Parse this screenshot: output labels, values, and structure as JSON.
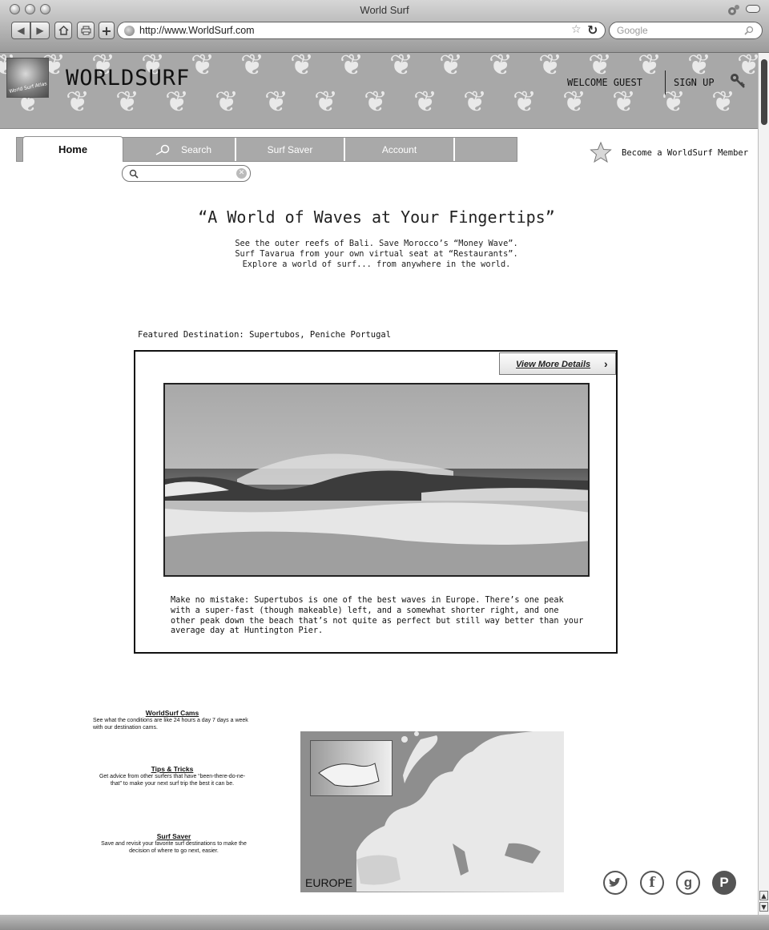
{
  "browser": {
    "window_title": "World Surf",
    "url": "http://www.WorldSurf.com",
    "search_placeholder": "Google"
  },
  "header": {
    "logo_text": "World Surf Atlas",
    "site_name": "WORLDSURF",
    "welcome": "WELCOME GUEST",
    "signup": "SIGN UP"
  },
  "nav": {
    "tabs": [
      {
        "label": "Home",
        "active": true
      },
      {
        "label": "Search",
        "active": false
      },
      {
        "label": "Surf Saver",
        "active": false
      },
      {
        "label": "Account",
        "active": false
      },
      {
        "label": "",
        "active": false
      }
    ],
    "member_link": "Become a WorldSurf Member"
  },
  "hero": {
    "title": "“A World of Waves at Your Fingertips”",
    "text": "See the outer reefs of Bali. Save Morocco’s “Money Wave”. Surf Tavarua from your own virtual seat at “Restaurants”. Explore a world of surf... from anywhere in the world."
  },
  "featured": {
    "label": "Featured Destination: Supertubos, Peniche Portugal",
    "details_button": "View More Details",
    "description": "Make no mistake: Supertubos is one of the best waves in Europe. There’s one peak with a super-fast (though makeable) left, and a somewhat shorter right, and one other peak down the beach that’s not quite as perfect but still way better than your average day at Huntington Pier."
  },
  "info_blocks": [
    {
      "title": "WorldSurf Cams",
      "text": "See what the conditions are like 24 hours a day 7 days a week with our destination cams."
    },
    {
      "title": "Tips & Tricks",
      "text": "Get advice from other surfers that have “been-there-do-ne-that” to make your next surf trip the best it can be."
    },
    {
      "title": "Surf Saver",
      "text": "Save and revisit your favorite surf destinations to make the decision of where to go next, easier."
    }
  ],
  "map": {
    "label": "EUROPE"
  },
  "social": [
    "twitter-icon",
    "facebook-icon",
    "google-icon",
    "pinterest-icon"
  ],
  "colors": {
    "banner": "#a8a8a8",
    "tab_bar": "#a9a9a9",
    "border": "#111111"
  }
}
